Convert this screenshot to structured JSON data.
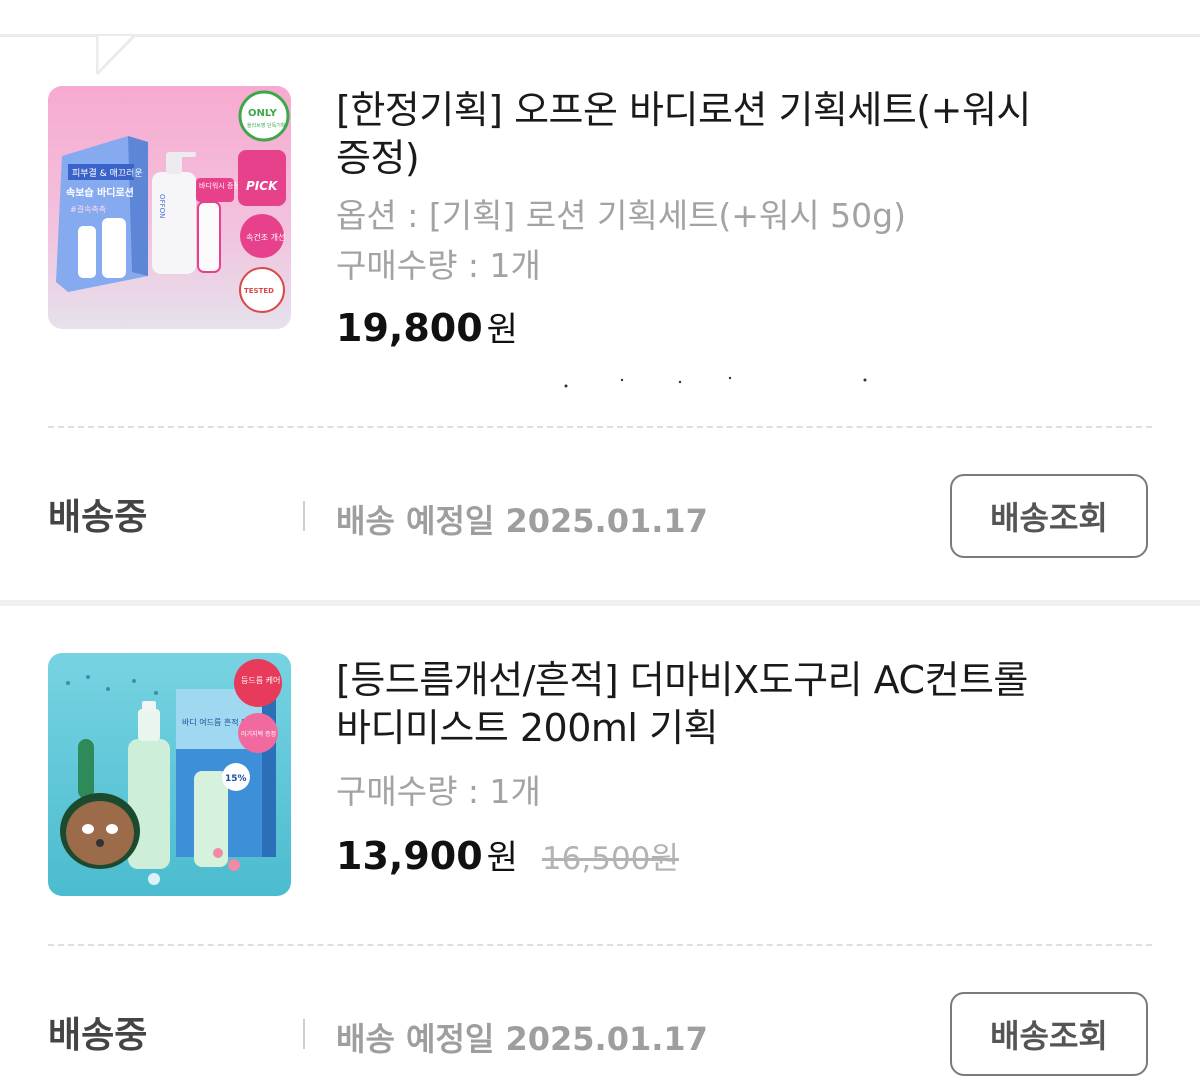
{
  "orders": [
    {
      "title": "[한정기획] 오프온 바디로션 기획세트(+워시 증정)",
      "option": "옵션 : [기획] 로션 기획세트(+워시 50g)",
      "quantity": "구매수량 : 1개",
      "price": "19,800",
      "currency": "원",
      "status": "배송중",
      "eta": "배송 예정일 2025.01.17",
      "track_button": "배송조회",
      "thumb_text": {
        "only_badge": "ONLY",
        "only_sub": "올리브영 단독기획",
        "box_line1": "피부결 & 매끄러운",
        "box_line2": "속보습 바디로션",
        "box_tag": "#결속촉촉",
        "pick_badge": "PICK",
        "washer_badge": "바디워시 증정",
        "dry_badge": "속건조 개선",
        "tested_badge": "TESTED",
        "bottle_brand": "OFFON"
      },
      "thumb_colors": {
        "bg_top": "#f4a7cf",
        "bg_bottom": "#e7e3ee",
        "box": "#7fa4ea",
        "accent": "#e8418c"
      }
    },
    {
      "title": "[등드름개선/흔적] 더마비X도구리 AC컨트롤 바디미스트 200ml 기획",
      "option": "",
      "quantity": "구매수량 : 1개",
      "price": "13,900",
      "currency": "원",
      "original_price": "16,500",
      "original_currency": "원",
      "status": "배송중",
      "eta": "배송 예정일 2025.01.17",
      "track_button": "배송조회",
      "thumb_text": {
        "red_badge": "등드름 케어",
        "pink_badge": "러기지택 증정",
        "box_line": "바디 여드름 흔적 미스트",
        "discount_badge": "15%"
      },
      "thumb_colors": {
        "bg": "#5bc7d8",
        "box": "#4a9ad8",
        "accent": "#e83a5a"
      }
    }
  ]
}
